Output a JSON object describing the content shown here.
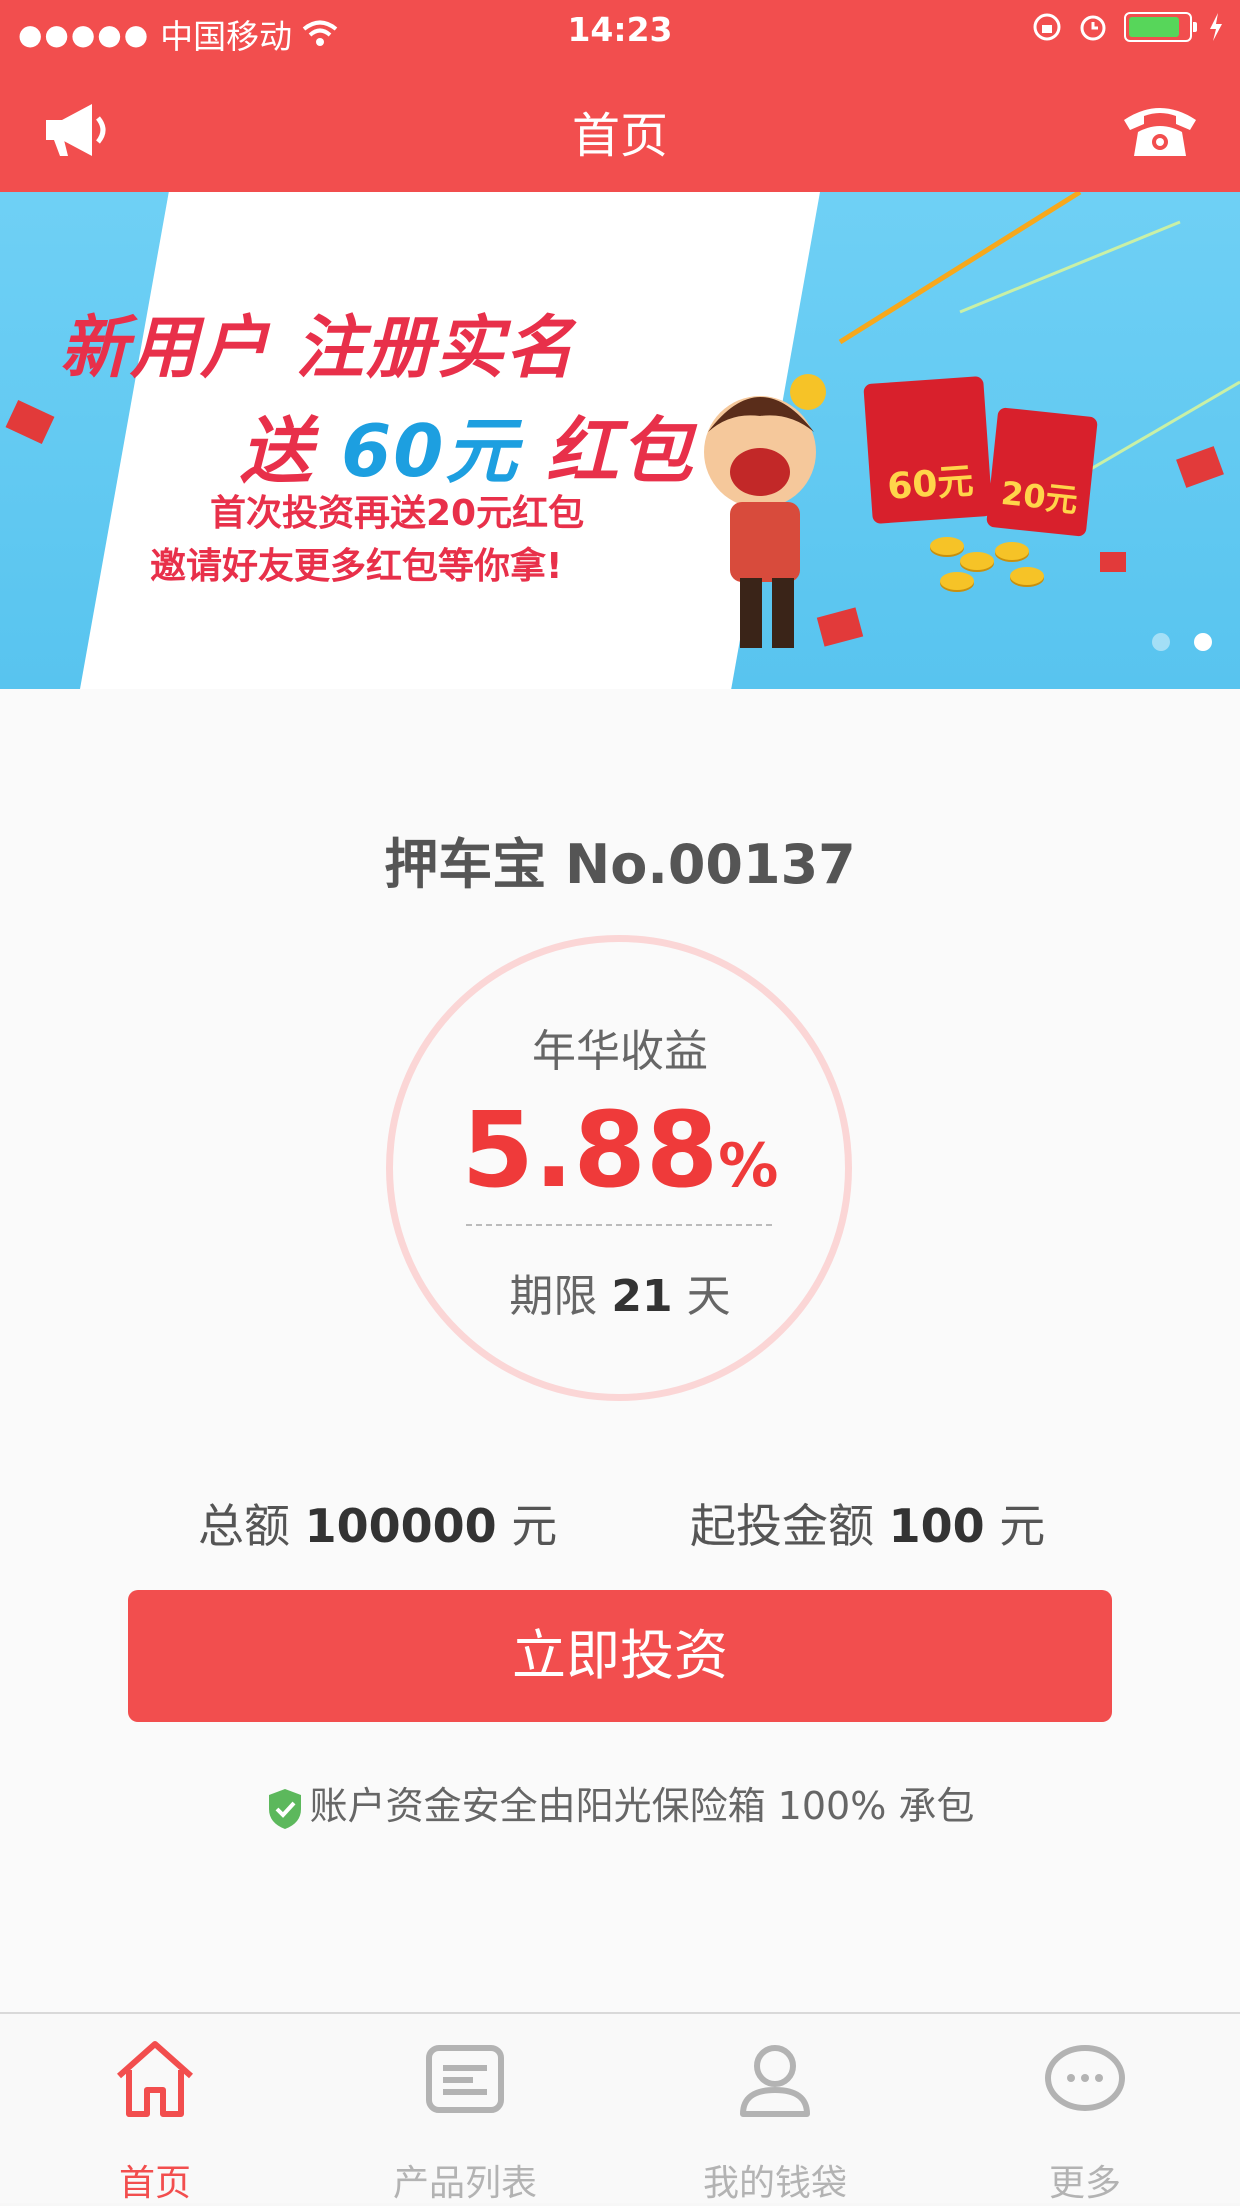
{
  "status_bar": {
    "signal_dots": "●●●●●",
    "carrier": "中国移动",
    "time": "14:23"
  },
  "nav": {
    "title": "首页",
    "left_icon": "megaphone-icon",
    "right_icon": "phone-icon"
  },
  "banner": {
    "line1": "新用户 注册实名",
    "line2_a": "送",
    "line2_b": "60元",
    "line2_c": "红包",
    "line3": "首次投资再送20元红包",
    "line4": "邀请好友更多红包等你拿!",
    "envelope_1": "60元",
    "envelope_2": "20元",
    "active_page": 2,
    "page_count": 2
  },
  "product": {
    "name": "押车宝 No.00137",
    "rate_label": "年华收益",
    "rate_value": "5.88",
    "rate_unit": "%",
    "term_label": "期限",
    "term_value": "21",
    "term_unit": "天",
    "total_label": "总额",
    "total_value": "100000",
    "total_unit": "元",
    "min_label": "起投金额",
    "min_value": "100",
    "min_unit": "元"
  },
  "invest_button": "立即投资",
  "safety_note": "账户资金安全由阳光保险箱 100% 承包",
  "tabs": [
    {
      "label": "首页",
      "icon": "home-icon",
      "active": true
    },
    {
      "label": "产品列表",
      "icon": "list-icon",
      "active": false
    },
    {
      "label": "我的钱袋",
      "icon": "user-icon",
      "active": false
    },
    {
      "label": "更多",
      "icon": "more-icon",
      "active": false
    }
  ],
  "colors": {
    "accent": "#f24e4e",
    "rate": "#ef3a3a",
    "banner_blue": "#58c4ef",
    "shield_green": "#5cb85c"
  }
}
